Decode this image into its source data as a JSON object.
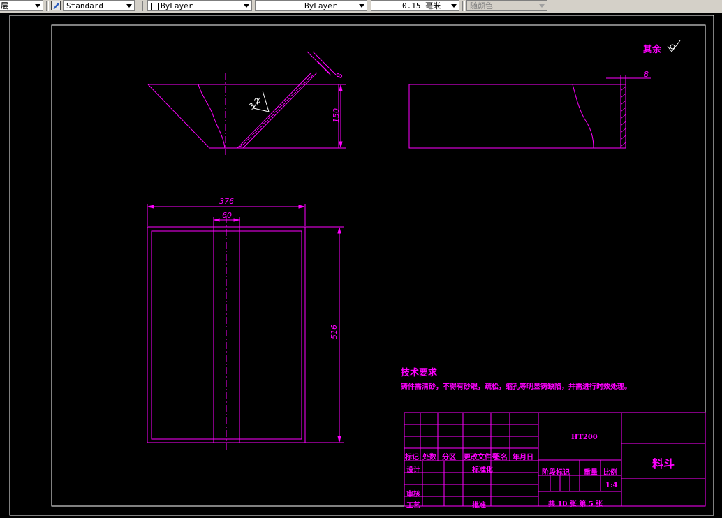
{
  "toolbar": {
    "left_fragment": "层",
    "text_style": "Standard",
    "color_control": "ByLayer",
    "linetype_control": "ByLayer",
    "lineweight_control": "0.15 毫米",
    "plot_style": "随颜色"
  },
  "drawing": {
    "surface_roughness": {
      "label": "其余",
      "symbol": "√"
    },
    "dims": {
      "plate_thickness_top": "8",
      "height_150": "150",
      "roughness_32": "3.2",
      "plate_thickness_side": "8",
      "width_376": "376",
      "slot_60": "60",
      "length_516": "516"
    },
    "tech_requirements": {
      "title": "技术要求",
      "text": "铸件需清砂，不得有砂眼，疏松，缩孔等明显铸缺陷，并需进行时效处理。"
    },
    "title_block": {
      "material": "HT200",
      "part_name": "料斗",
      "revision_row": [
        "标记",
        "处数",
        "分区",
        "更改文件号",
        "签名",
        "年月日"
      ],
      "design_label": "设计",
      "standardize_label": "标准化",
      "review_label": "审核",
      "process_label": "工艺",
      "approve_label": "批准",
      "stage_label": "阶段标记",
      "weight_label": "重量",
      "scale_label": "比例",
      "scale_value": "1:4",
      "sheets_text": "共 10 张  第 5 张"
    }
  },
  "colors": {
    "drawing": "#ff00ff",
    "background": "#000000",
    "frame": "#ffffff",
    "roughness_mark": "#ffffff"
  }
}
